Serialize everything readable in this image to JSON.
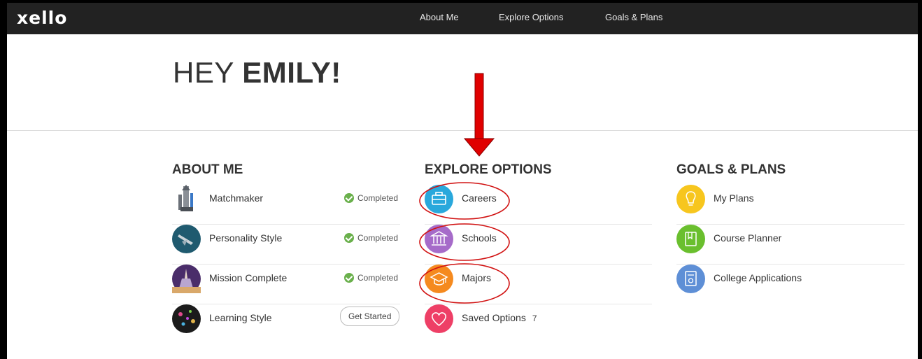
{
  "header": {
    "logo": "xello",
    "nav": [
      "About Me",
      "Explore Options",
      "Goals & Plans"
    ]
  },
  "greeting": {
    "prefix": "HEY",
    "name": "EMILY!"
  },
  "about_me": {
    "title": "ABOUT ME",
    "items": [
      {
        "label": "Matchmaker",
        "status": "Completed",
        "icon": "matchmaker-rocket-icon"
      },
      {
        "label": "Personality Style",
        "status": "Completed",
        "icon": "personality-style-icon"
      },
      {
        "label": "Mission Complete",
        "status": "Completed",
        "icon": "mission-complete-icon"
      },
      {
        "label": "Learning Style",
        "action": "Get Started",
        "icon": "learning-style-icon"
      }
    ]
  },
  "explore_options": {
    "title": "EXPLORE OPTIONS",
    "items": [
      {
        "label": "Careers",
        "icon": "briefcase-icon",
        "color": "#29a8dc"
      },
      {
        "label": "Schools",
        "icon": "building-icon",
        "color": "#a66bc9"
      },
      {
        "label": "Majors",
        "icon": "graduation-cap-icon",
        "color": "#f58a1f"
      },
      {
        "label": "Saved Options",
        "count": "7",
        "icon": "heart-icon",
        "color": "#ee3f66"
      }
    ]
  },
  "goals_plans": {
    "title": "GOALS & PLANS",
    "items": [
      {
        "label": "My Plans",
        "icon": "lightbulb-icon",
        "color": "#f7c61e"
      },
      {
        "label": "Course Planner",
        "icon": "book-icon",
        "color": "#6abf2e"
      },
      {
        "label": "College Applications",
        "icon": "application-certificate-icon",
        "color": "#5e8fd6"
      }
    ]
  },
  "annotations": {
    "arrow_color": "#e00000",
    "highlight_color": "#d11111"
  }
}
